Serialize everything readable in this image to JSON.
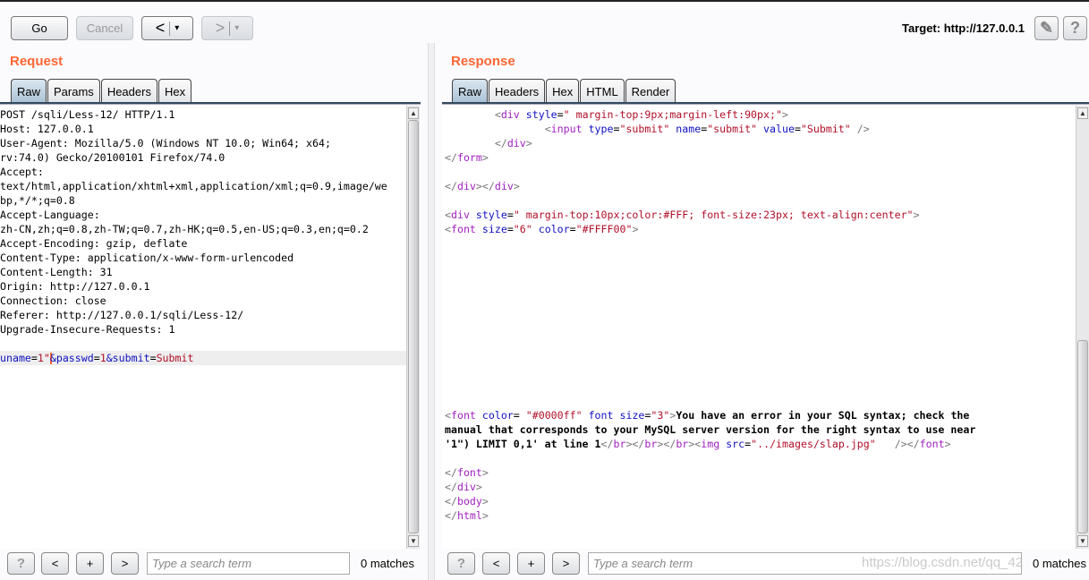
{
  "toolbar": {
    "go": "Go",
    "cancel": "Cancel",
    "back": "<",
    "forward": ">",
    "dropdown": "▾",
    "target": "Target: http://127.0.0.1",
    "edit_icon": "pencil-icon",
    "help": "?"
  },
  "request": {
    "title": "Request",
    "tabs": [
      {
        "label": "Raw",
        "active": true
      },
      {
        "label": "Params"
      },
      {
        "label": "Headers"
      },
      {
        "label": "Hex"
      }
    ],
    "lines": [
      [
        [
          "x",
          "POST /sqli/Less-12/ HTTP/1.1"
        ]
      ],
      [
        [
          "x",
          "Host: 127.0.0.1"
        ]
      ],
      [
        [
          "x",
          "User-Agent: Mozilla/5.0 (Windows NT 10.0; Win64; x64;"
        ]
      ],
      [
        [
          "x",
          "rv:74.0) Gecko/20100101 Firefox/74.0"
        ]
      ],
      [
        [
          "x",
          "Accept:"
        ]
      ],
      [
        [
          "x",
          "text/html,application/xhtml+xml,application/xml;q=0.9,image/we"
        ]
      ],
      [
        [
          "x",
          "bp,*/*;q=0.8"
        ]
      ],
      [
        [
          "x",
          "Accept-Language:"
        ]
      ],
      [
        [
          "x",
          "zh-CN,zh;q=0.8,zh-TW;q=0.7,zh-HK;q=0.5,en-US;q=0.3,en;q=0.2"
        ]
      ],
      [
        [
          "x",
          "Accept-Encoding: gzip, deflate"
        ]
      ],
      [
        [
          "x",
          "Content-Type: application/x-www-form-urlencoded"
        ]
      ],
      [
        [
          "x",
          "Content-Length: 31"
        ]
      ],
      [
        [
          "x",
          "Origin: http://127.0.0.1"
        ]
      ],
      [
        [
          "x",
          "Connection: close"
        ]
      ],
      [
        [
          "x",
          "Referer: http://127.0.0.1/sqli/Less-12/"
        ]
      ],
      [
        [
          "x",
          "Upgrade-Insecure-Requests: 1"
        ]
      ],
      [],
      [
        [
          "a",
          "uname"
        ],
        [
          "x",
          "="
        ],
        [
          "v",
          "1\""
        ],
        [
          "caret",
          ""
        ],
        [
          "a",
          "&passwd"
        ],
        [
          "x",
          "="
        ],
        [
          "v",
          "1"
        ],
        [
          "a",
          "&submit"
        ],
        [
          "x",
          "="
        ],
        [
          "v",
          "Submit"
        ]
      ]
    ],
    "highlight_line": 17,
    "search": {
      "placeholder": "Type a search term",
      "matches": "0 matches"
    }
  },
  "response": {
    "title": "Response",
    "tabs": [
      {
        "label": "Raw",
        "active": true
      },
      {
        "label": "Headers"
      },
      {
        "label": "Hex"
      },
      {
        "label": "HTML"
      },
      {
        "label": "Render"
      }
    ],
    "lines": [
      [
        [
          "x",
          "        "
        ],
        [
          "p",
          "<"
        ],
        [
          "t",
          "div"
        ],
        [
          "x",
          " "
        ],
        [
          "a",
          "style"
        ],
        [
          "x",
          "="
        ],
        [
          "v",
          "\" margin-top:9px;margin-left:90px;\""
        ],
        [
          "p",
          ">"
        ]
      ],
      [
        [
          "x",
          "                "
        ],
        [
          "p",
          "<"
        ],
        [
          "t",
          "input"
        ],
        [
          "x",
          " "
        ],
        [
          "a",
          "type"
        ],
        [
          "x",
          "="
        ],
        [
          "v",
          "\"submit\""
        ],
        [
          "x",
          " "
        ],
        [
          "a",
          "name"
        ],
        [
          "x",
          "="
        ],
        [
          "v",
          "\"submit\""
        ],
        [
          "x",
          " "
        ],
        [
          "a",
          "value"
        ],
        [
          "x",
          "="
        ],
        [
          "v",
          "\"Submit\""
        ],
        [
          "x",
          " "
        ],
        [
          "p",
          "/>"
        ]
      ],
      [
        [
          "x",
          "        "
        ],
        [
          "p",
          "</"
        ],
        [
          "t",
          "div"
        ],
        [
          "p",
          ">"
        ]
      ],
      [
        [
          "p",
          "</"
        ],
        [
          "t",
          "form"
        ],
        [
          "p",
          ">"
        ]
      ],
      [],
      [
        [
          "p",
          "</"
        ],
        [
          "t",
          "div"
        ],
        [
          "p",
          "></"
        ],
        [
          "t",
          "div"
        ],
        [
          "p",
          ">"
        ]
      ],
      [],
      [
        [
          "p",
          "<"
        ],
        [
          "t",
          "div"
        ],
        [
          "x",
          " "
        ],
        [
          "a",
          "style"
        ],
        [
          "x",
          "="
        ],
        [
          "v",
          "\" margin-top:10px;color:#FFF; font-size:23px; text-align:center\""
        ],
        [
          "p",
          ">"
        ]
      ],
      [
        [
          "p",
          "<"
        ],
        [
          "t",
          "font"
        ],
        [
          "x",
          " "
        ],
        [
          "a",
          "size"
        ],
        [
          "x",
          "="
        ],
        [
          "v",
          "\"6\""
        ],
        [
          "x",
          " "
        ],
        [
          "a",
          "color"
        ],
        [
          "x",
          "="
        ],
        [
          "v",
          "\"#FFFF00\""
        ],
        [
          "p",
          ">"
        ]
      ],
      [],
      [],
      [],
      [],
      [],
      [],
      [],
      [],
      [],
      [],
      [],
      [],
      [
        [
          "p",
          "<"
        ],
        [
          "t",
          "font"
        ],
        [
          "x",
          " "
        ],
        [
          "a",
          "color"
        ],
        [
          "x",
          "= "
        ],
        [
          "v",
          "\"#0000ff\""
        ],
        [
          "x",
          " "
        ],
        [
          "a",
          "font size"
        ],
        [
          "x",
          "="
        ],
        [
          "v",
          "\"3\""
        ],
        [
          "p",
          ">"
        ],
        [
          "b",
          "You have an error in your SQL syntax; check the"
        ]
      ],
      [
        [
          "b",
          "manual that corresponds to your MySQL server version for the right syntax to use near"
        ]
      ],
      [
        [
          "b",
          "'1\") LIMIT 0,1' at line 1"
        ],
        [
          "p",
          "</"
        ],
        [
          "t",
          "br"
        ],
        [
          "p",
          "></"
        ],
        [
          "t",
          "br"
        ],
        [
          "p",
          "></"
        ],
        [
          "t",
          "br"
        ],
        [
          "p",
          "><"
        ],
        [
          "t",
          "img"
        ],
        [
          "x",
          " "
        ],
        [
          "a",
          "src"
        ],
        [
          "x",
          "="
        ],
        [
          "v",
          "\"../images/slap.jpg\""
        ],
        [
          "x",
          "   "
        ],
        [
          "p",
          "/></"
        ],
        [
          "t",
          "font"
        ],
        [
          "p",
          ">"
        ]
      ],
      [],
      [
        [
          "p",
          "</"
        ],
        [
          "t",
          "font"
        ],
        [
          "p",
          ">"
        ]
      ],
      [
        [
          "p",
          "</"
        ],
        [
          "t",
          "div"
        ],
        [
          "p",
          ">"
        ]
      ],
      [
        [
          "p",
          "</"
        ],
        [
          "t",
          "body"
        ],
        [
          "p",
          ">"
        ]
      ],
      [
        [
          "p",
          "</"
        ],
        [
          "t",
          "html"
        ],
        [
          "p",
          ">"
        ]
      ]
    ],
    "search": {
      "placeholder": "Type a search term",
      "matches": "0 matches"
    }
  },
  "bottom_buttons": {
    "help": "?",
    "prev": "<",
    "add": "+",
    "next": ">"
  },
  "watermark": "https://blog.csdn.net/qq_42"
}
